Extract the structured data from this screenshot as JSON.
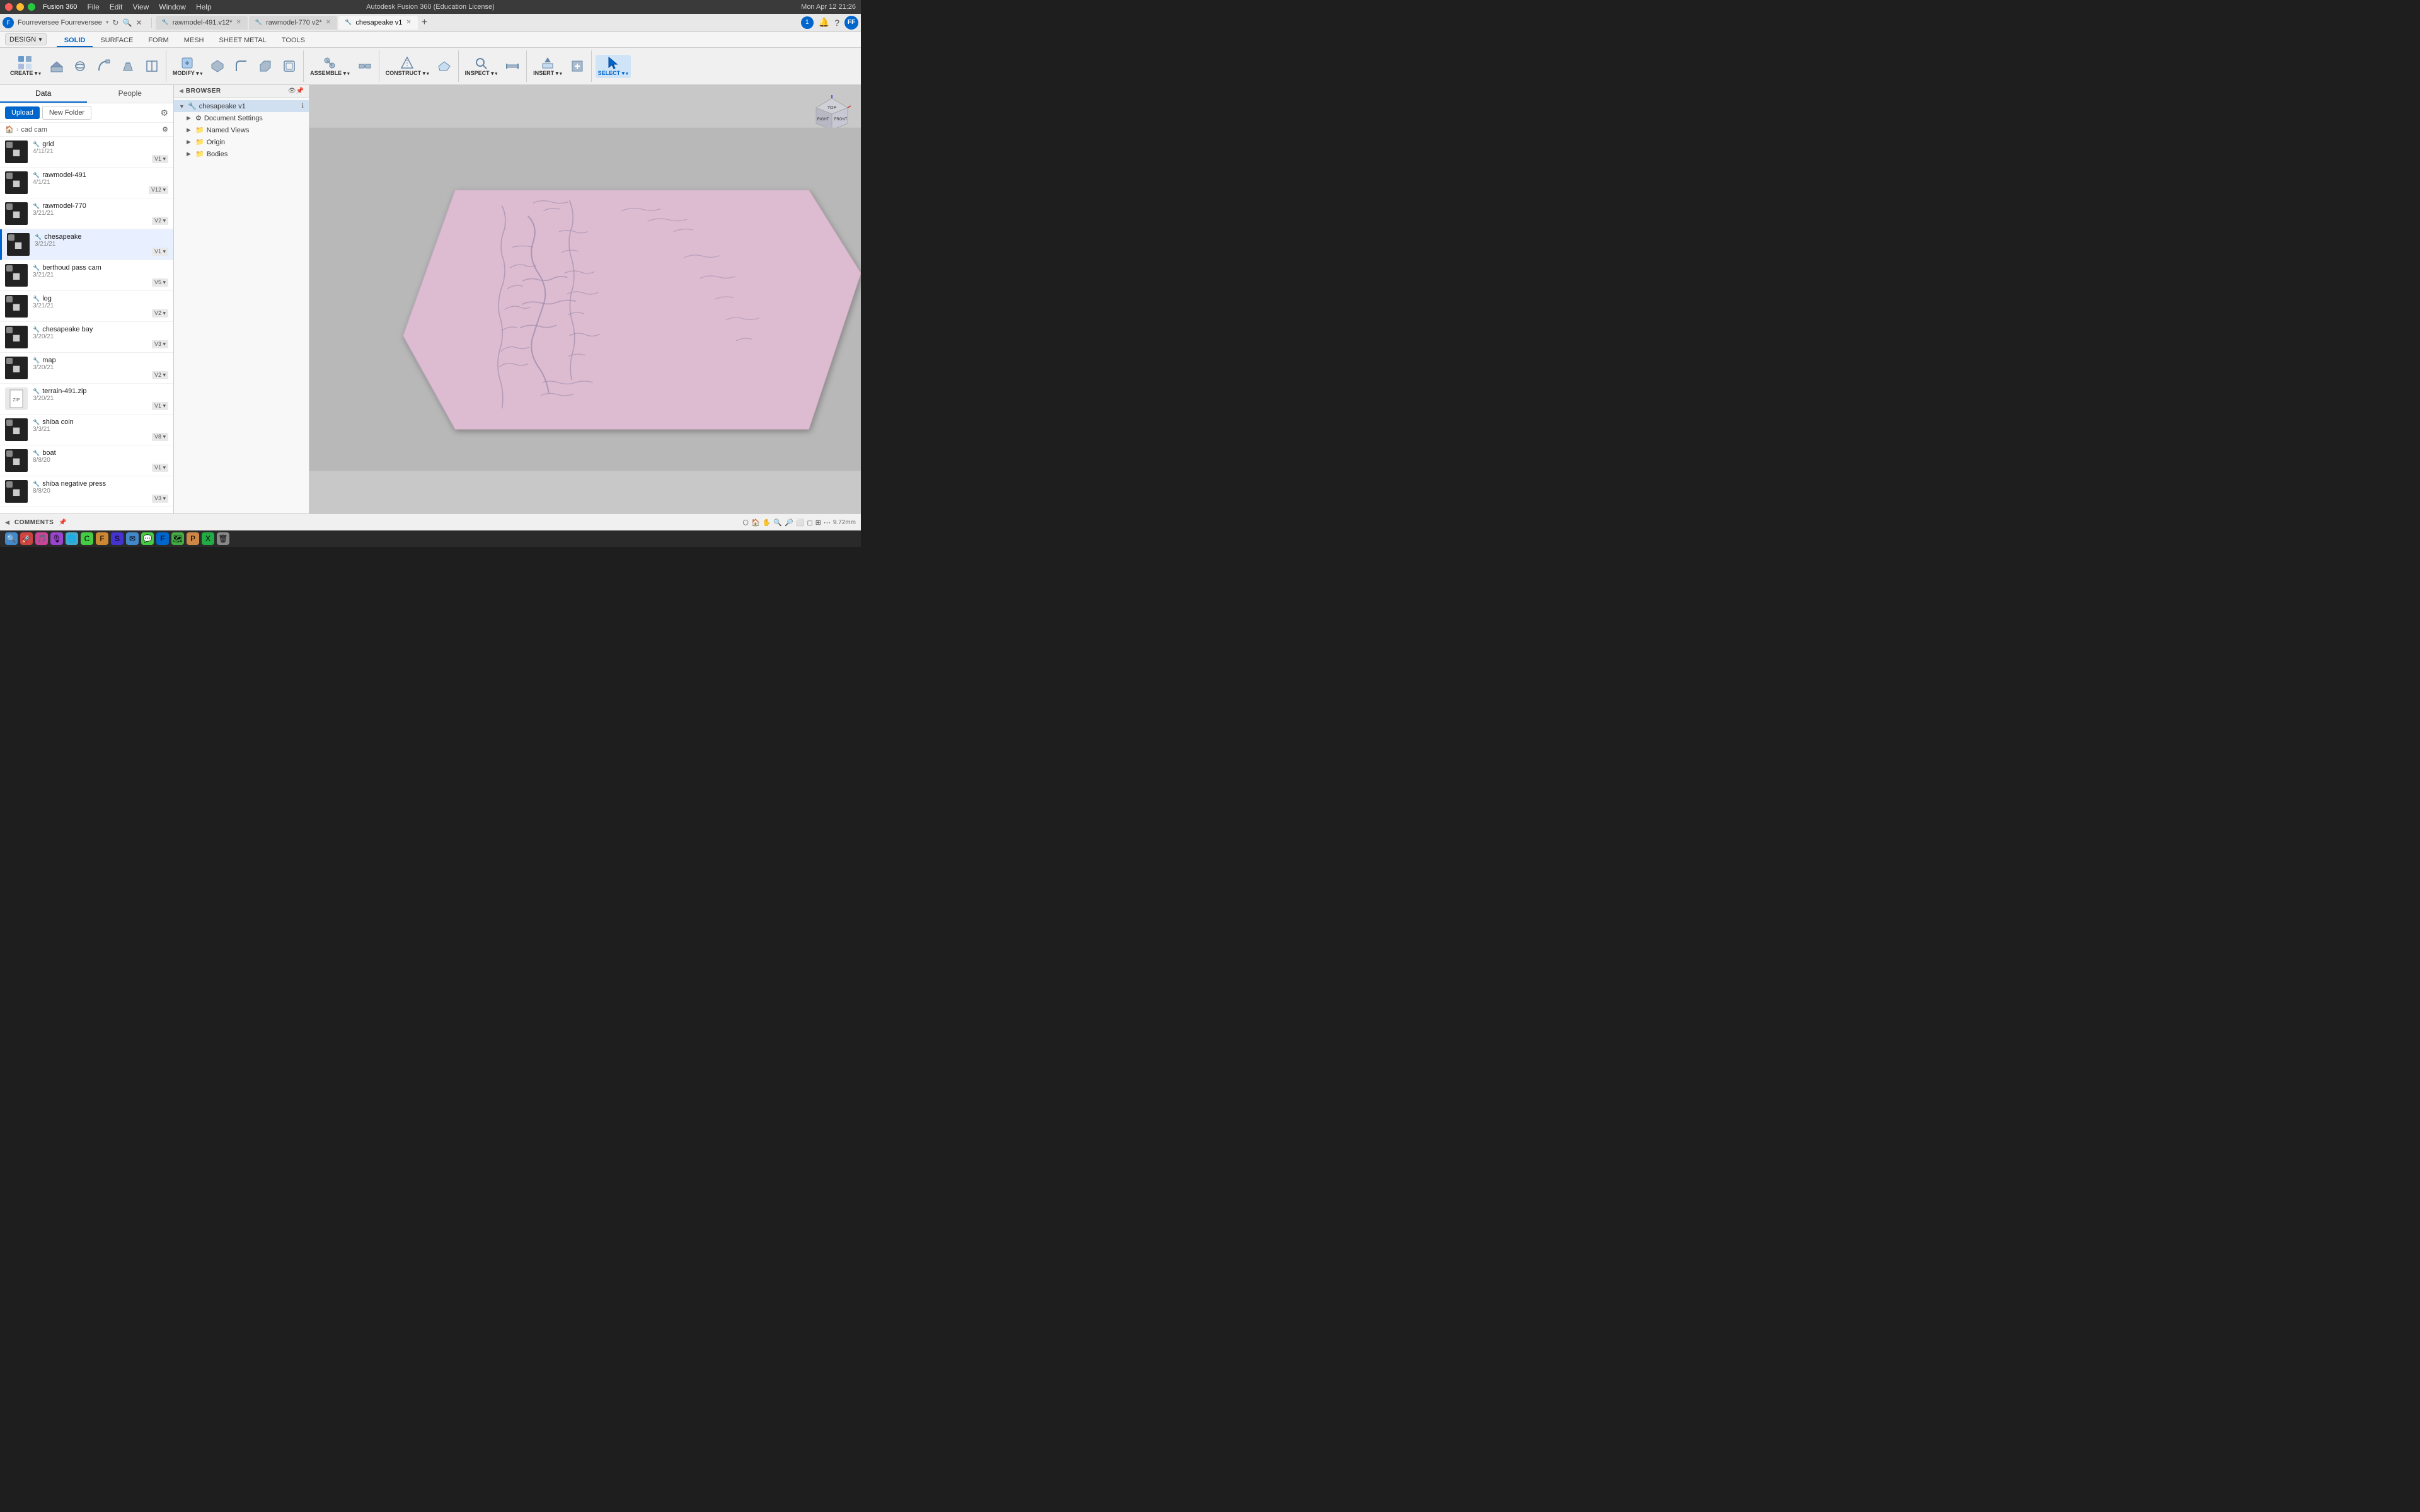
{
  "app": {
    "name": "Fusion 360",
    "title": "Autodesk Fusion 360 (Education License)",
    "date": "Mon Apr 12  21:26"
  },
  "menus": [
    "File",
    "Edit",
    "View",
    "Window",
    "Help"
  ],
  "tabs": [
    {
      "id": "rawmodel491",
      "label": "rawmodel-491.v12*",
      "active": false,
      "closable": true
    },
    {
      "id": "rawmodel770",
      "label": "rawmodel-770 v2*",
      "active": false,
      "closable": true
    },
    {
      "id": "chesapeake",
      "label": "chesapeake v1",
      "active": true,
      "closable": true
    }
  ],
  "workspace": {
    "dropdown_label": "DESIGN",
    "toolbar_tabs": [
      "SOLID",
      "SURFACE",
      "FORM",
      "MESH",
      "SHEET METAL",
      "TOOLS"
    ],
    "active_toolbar_tab": "SOLID"
  },
  "toolbar_groups": [
    {
      "label": "CREATE",
      "items": [
        {
          "icon": "◻",
          "label": ""
        },
        {
          "icon": "⬡",
          "label": ""
        },
        {
          "icon": "○",
          "label": ""
        },
        {
          "icon": "⊡",
          "label": ""
        },
        {
          "icon": "⊟",
          "label": ""
        }
      ]
    },
    {
      "label": "MODIFY",
      "items": [
        {
          "icon": "⬠",
          "label": ""
        },
        {
          "icon": "◈",
          "label": ""
        },
        {
          "icon": "⬡",
          "label": ""
        },
        {
          "icon": "⊞",
          "label": ""
        },
        {
          "icon": "⬣",
          "label": ""
        }
      ]
    },
    {
      "label": "ASSEMBLE",
      "items": [
        {
          "icon": "⚙",
          "label": ""
        },
        {
          "icon": "🔗",
          "label": ""
        }
      ]
    },
    {
      "label": "CONSTRUCT",
      "items": [
        {
          "icon": "⬟",
          "label": ""
        },
        {
          "icon": "◈",
          "label": ""
        }
      ]
    },
    {
      "label": "INSPECT",
      "items": [
        {
          "icon": "⬡",
          "label": ""
        },
        {
          "icon": "◎",
          "label": ""
        }
      ]
    },
    {
      "label": "INSERT",
      "items": [
        {
          "icon": "◻",
          "label": ""
        },
        {
          "icon": "⊞",
          "label": ""
        }
      ]
    },
    {
      "label": "SELECT",
      "items": [
        {
          "icon": "↖",
          "label": ""
        }
      ]
    }
  ],
  "sidebar": {
    "tabs": [
      "Data",
      "People"
    ],
    "active_tab": "Data",
    "upload_label": "Upload",
    "new_folder_label": "New Folder",
    "path": "cad cam",
    "items": [
      {
        "name": "grid",
        "date": "4/11/21",
        "version": "V1",
        "thumb_type": "dark"
      },
      {
        "name": "rawmodel-491",
        "date": "4/1/21",
        "version": "V12",
        "thumb_type": "dark"
      },
      {
        "name": "rawmodel-770",
        "date": "3/21/21",
        "version": "V2",
        "thumb_type": "dark"
      },
      {
        "name": "chesapeake",
        "date": "3/21/21",
        "version": "V1",
        "thumb_type": "dark",
        "active": true
      },
      {
        "name": "berthoud pass cam",
        "date": "3/21/21",
        "version": "V5",
        "thumb_type": "dark"
      },
      {
        "name": "log",
        "date": "3/21/21",
        "version": "V2",
        "thumb_type": "dark"
      },
      {
        "name": "chesapeake bay",
        "date": "3/20/21",
        "version": "V3",
        "thumb_type": "dark"
      },
      {
        "name": "map",
        "date": "3/20/21",
        "version": "V2",
        "thumb_type": "dark"
      },
      {
        "name": "terrain-491.zip",
        "date": "3/20/21",
        "version": "V1",
        "thumb_type": "light"
      },
      {
        "name": "shiba coin",
        "date": "3/3/21",
        "version": "V8",
        "thumb_type": "dark"
      },
      {
        "name": "boat",
        "date": "8/8/20",
        "version": "V1",
        "thumb_type": "dark"
      },
      {
        "name": "shiba negative press",
        "date": "8/8/20",
        "version": "V3",
        "thumb_type": "dark"
      }
    ]
  },
  "browser": {
    "title": "BROWSER",
    "root_name": "chesapeake v1",
    "items": [
      {
        "label": "Document Settings",
        "level": 1,
        "expandable": true,
        "icon": "⚙"
      },
      {
        "label": "Named Views",
        "level": 1,
        "expandable": true,
        "icon": "📁"
      },
      {
        "label": "Origin",
        "level": 1,
        "expandable": true,
        "icon": "📁"
      },
      {
        "label": "Bodies",
        "level": 1,
        "expandable": true,
        "icon": "📁"
      }
    ]
  },
  "bottom": {
    "comments_label": "COMMENTS"
  },
  "statusbar": {
    "zoom": "9.72mm"
  }
}
